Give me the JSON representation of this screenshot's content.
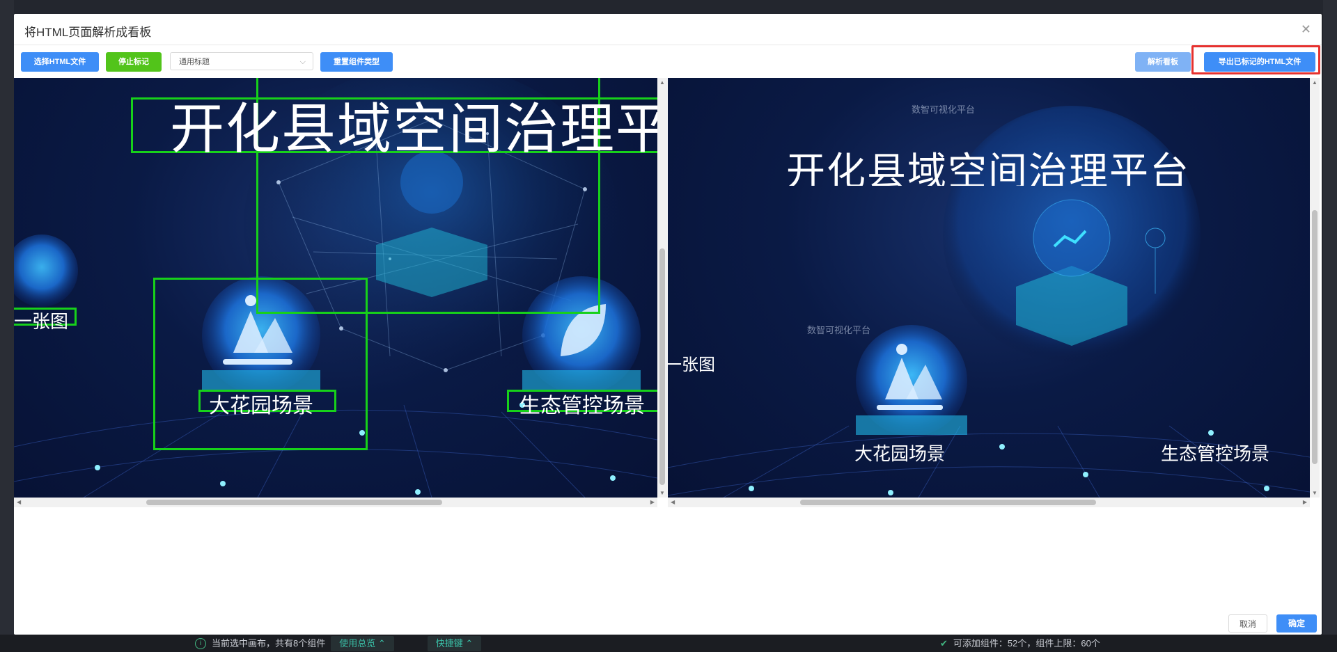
{
  "background_app": {
    "status_left": "当前选中画布，共有8个组件",
    "overview_button": "使用总览",
    "shortcut_button": "快捷键",
    "status_right": "可添加组件：52个，组件上限：60个"
  },
  "modal": {
    "title": "将HTML页面解析成看板",
    "toolbar": {
      "select_html": "选择HTML文件",
      "stop_mark": "停止标记",
      "type_select_value": "通用标题",
      "reset_type": "重置组件类型",
      "parse_board": "解析看板",
      "export_marked": "导出已标记的HTML文件"
    },
    "left_preview": {
      "title": "开化县域空间治理平",
      "side_label": "一张图",
      "scene1": "大花园场景",
      "scene2": "生态管控场景"
    },
    "right_preview": {
      "watermark_top": "数智可视化平台",
      "title": "开化县域空间治理平台",
      "side_label": "一张图",
      "watermark_mid": "数智可视化平台",
      "scene1": "大花园场景",
      "scene2": "生态管控场景"
    },
    "footer": {
      "cancel": "取消",
      "confirm": "确定"
    }
  },
  "colors": {
    "primary": "#3e8ef7",
    "success": "#52c41a",
    "highlight": "#e6312e",
    "mark_box": "#17d11a"
  }
}
